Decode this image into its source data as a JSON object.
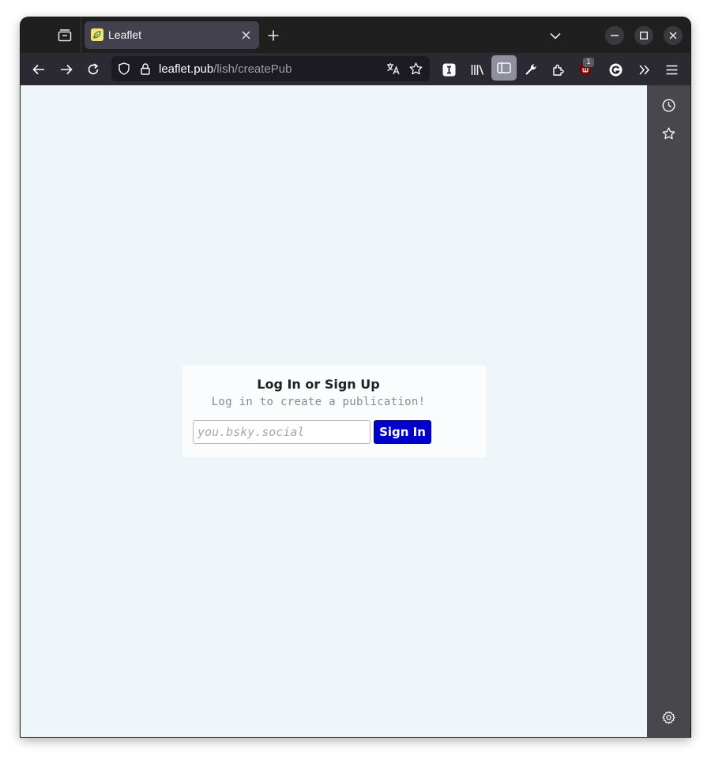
{
  "browser": {
    "tab": {
      "title": "Leaflet"
    },
    "url": {
      "host": "leaflet.pub",
      "path": "/lish/createPub"
    },
    "extension_badge": "1"
  },
  "icons": [
    "tab-overview-icon",
    "favicon-leaf-icon",
    "close-tab-icon",
    "new-tab-icon",
    "tab-list-chevron-icon",
    "minimize-icon",
    "maximize-icon",
    "close-window-icon",
    "back-icon",
    "forward-icon",
    "reload-icon",
    "shield-icon",
    "lock-icon",
    "translate-icon",
    "bookmark-star-icon",
    "extension-i-icon",
    "library-icon",
    "sidebar-toggle-icon",
    "wrench-icon",
    "puzzle-icon",
    "ublock-icon",
    "grammarly-icon",
    "overflow-icon",
    "menu-icon",
    "history-icon",
    "bookmarks-icon",
    "settings-icon"
  ],
  "colors": {
    "accent": "#0000cc",
    "content_bg": "#eff6f9",
    "card_bg": "#fafcfd"
  },
  "login": {
    "title": "Log In or Sign Up",
    "subtitle": "Log in to create a publication!",
    "input_placeholder": "you.bsky.social",
    "button_label": "Sign In"
  }
}
